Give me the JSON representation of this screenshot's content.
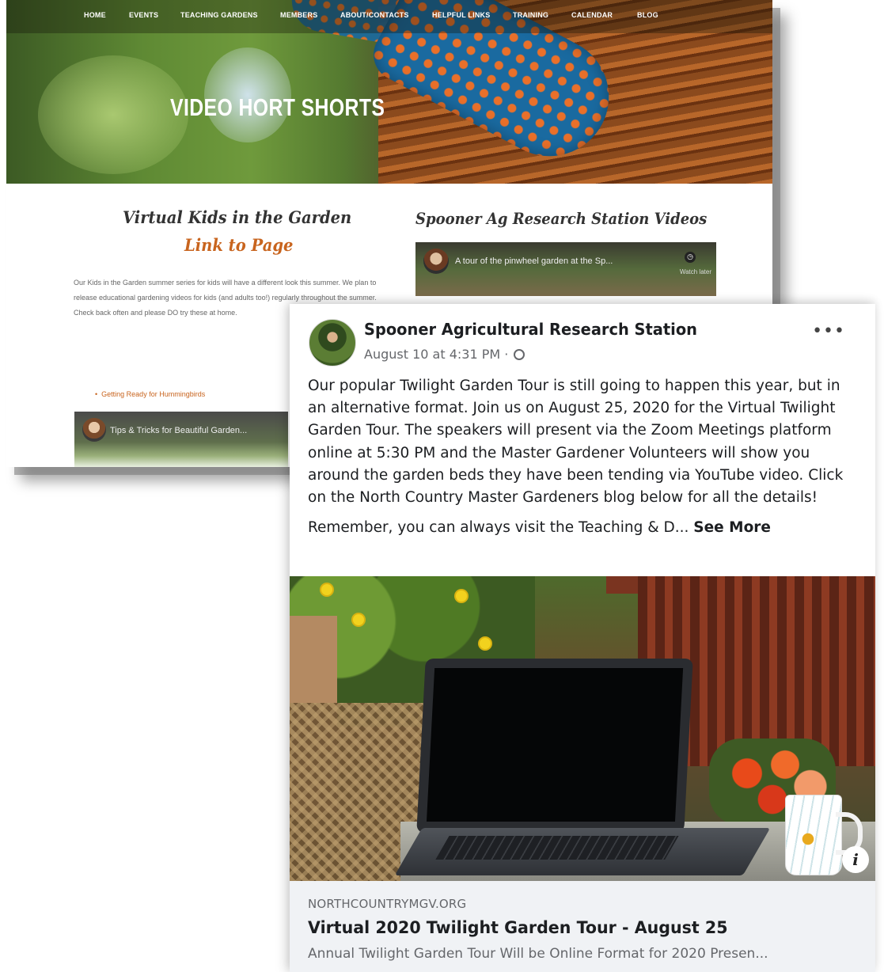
{
  "website": {
    "nav": [
      "HOME",
      "EVENTS",
      "TEACHING GARDENS",
      "MEMBERS",
      "ABOUT/CONTACTS",
      "HELPFUL LINKS",
      "TRAINING",
      "CALENDAR",
      "BLOG"
    ],
    "hero_title": "VIDEO HORT SHORTS",
    "left_heading": "Virtual Kids in the Garden",
    "left_link": "Link to Page",
    "left_paragraph": "Our Kids in the Garden summer series for kids will have a different look this summer. We plan to release educational gardening videos for kids (and adults too!) regularly throughout the summer. Check back often and please DO try these at home.",
    "bullet_link": "Getting Ready for Hummingbirds",
    "left_video_title": "Tips & Tricks for Beautiful Garden...",
    "right_heading": "Spooner Ag Research Station Videos",
    "right_video_title": "A tour of the pinwheel garden at the Sp...",
    "right_video_watch_later": "Watch later"
  },
  "post": {
    "page_name": "Spooner Agricultural Research Station",
    "timestamp": "August 10 at 4:31 PM · ",
    "body_paragraph_1": "Our popular Twilight Garden Tour is still going to happen this year, but in an alternative format.  Join us on August 25, 2020 for the Virtual Twilight Garden Tour.  The speakers will present via the Zoom Meetings platform online at 5:30 PM and the Master Gardener Volunteers will show you around the garden beds they have been tending via YouTube video.  Click on the North Country Master Gardeners blog below for all the details!",
    "body_paragraph_2": "Remember, you can always visit the Teaching & D... ",
    "see_more": "See More",
    "more_icon": "•••",
    "info_icon": "i",
    "link_domain": "NORTHCOUNTRYMGV.ORG",
    "link_title": "Virtual 2020 Twilight Garden Tour - August 25",
    "link_description": "Annual Twilight Garden Tour Will be Online Format for 2020 Presen..."
  }
}
